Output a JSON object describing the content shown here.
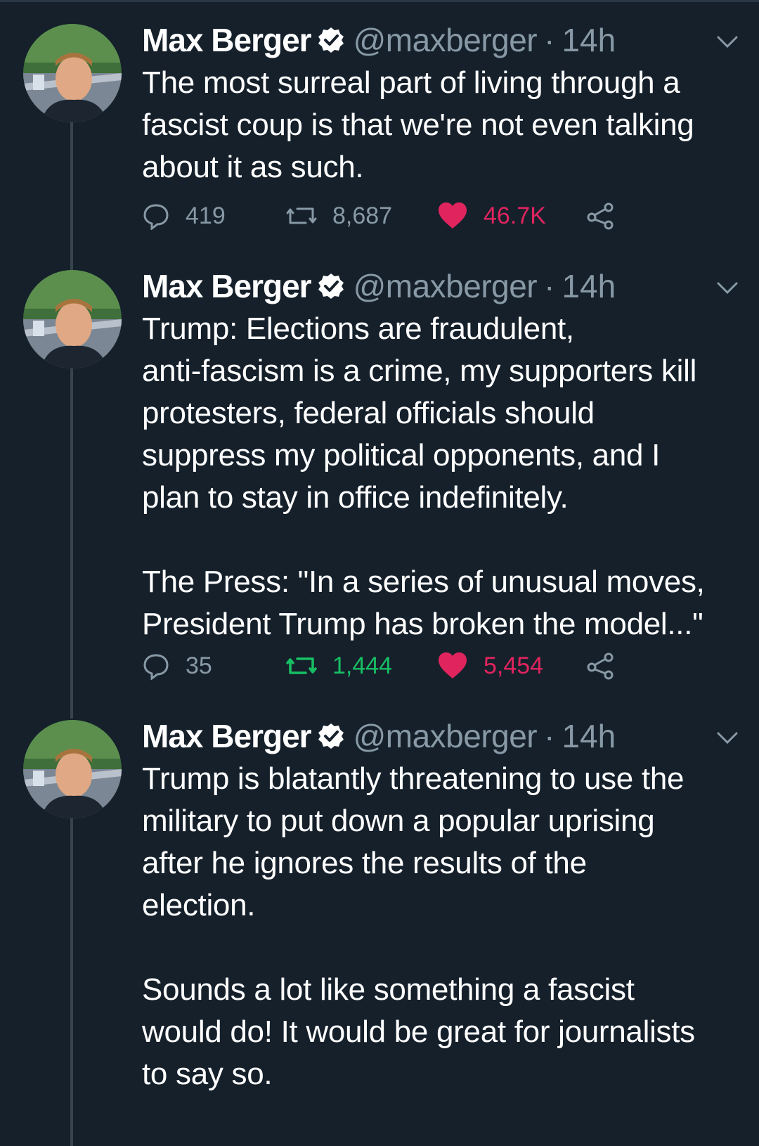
{
  "colors": {
    "background": "#15202b",
    "secondary_text": "#8899a6",
    "like": "#e0245e",
    "retweet_active": "#17bf63",
    "verified": "#ffffff"
  },
  "tweets": [
    {
      "name": "Max Berger",
      "handle": "@maxberger",
      "dot": "·",
      "time": "14h",
      "text": "The most surreal part of living through a\nfascist coup is that we're not even talking\nabout it as such.",
      "replies": "419",
      "retweets": "8,687",
      "likes": "46.7K",
      "retweeted": false,
      "liked": true,
      "icons": [
        "reply-icon",
        "retweet-icon",
        "heart-icon",
        "share-icon",
        "chevron-down-icon",
        "verified-badge-icon"
      ]
    },
    {
      "name": "Max Berger",
      "handle": "@maxberger",
      "dot": "·",
      "time": "14h",
      "text": "Trump: Elections are fraudulent,\nanti-fascism is a crime, my supporters kill\nprotesters, federal officials should\nsuppress my political opponents, and I\nplan to stay in office indefinitely.\n\nThe Press: \"In a series of unusual moves,\nPresident Trump has broken the model...\"",
      "replies": "35",
      "retweets": "1,444",
      "likes": "5,454",
      "retweeted": true,
      "liked": true,
      "icons": [
        "reply-icon",
        "retweet-icon",
        "heart-icon",
        "share-icon",
        "chevron-down-icon",
        "verified-badge-icon"
      ]
    },
    {
      "name": "Max Berger",
      "handle": "@maxberger",
      "dot": "·",
      "time": "14h",
      "text": "Trump is blatantly threatening to use the\nmilitary to put down a popular uprising\nafter he ignores the results of the\nelection.\n\nSounds a lot like something a fascist\nwould do! It would be great for journalists\nto say so.",
      "icons": [
        "chevron-down-icon",
        "verified-badge-icon"
      ]
    }
  ]
}
